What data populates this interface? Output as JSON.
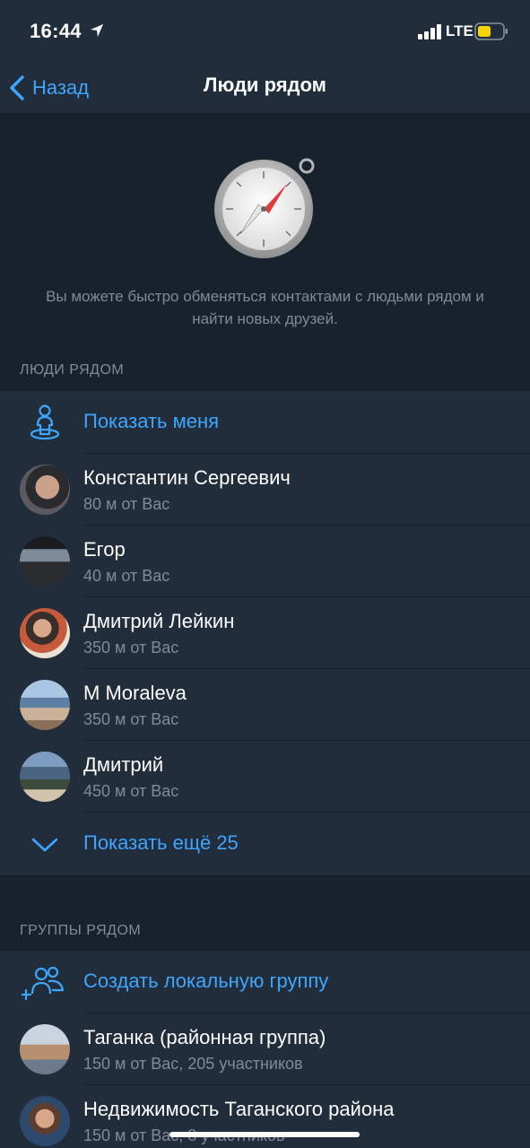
{
  "status_bar": {
    "time": "16:44",
    "network": "LTE",
    "battery_color": "#f5d400"
  },
  "nav": {
    "back_label": "Назад",
    "title": "Люди рядом"
  },
  "hero": {
    "description": "Вы можете быстро обменяться контактами с людьми рядом и найти новых друзей."
  },
  "people_section": {
    "header": "ЛЮДИ РЯДОМ",
    "show_me_label": "Показать меня",
    "people": [
      {
        "name": "Константин Сергеевич",
        "distance": "80 м от Вас"
      },
      {
        "name": "Егор",
        "distance": "40 м от Вас"
      },
      {
        "name": "Дмитрий Лейкин",
        "distance": "350 м от Вас"
      },
      {
        "name": "M Moraleva",
        "distance": "350 м от Вас"
      },
      {
        "name": "Дмитрий",
        "distance": "450 м от Вас"
      }
    ],
    "show_more_label": "Показать ещё 25"
  },
  "groups_section": {
    "header": "ГРУППЫ РЯДОМ",
    "create_label": "Создать локальную группу",
    "groups": [
      {
        "name": "Таганка (районная группа)",
        "info": "150 м от Вас, 205 участников"
      },
      {
        "name": "Недвижимость Таганского района",
        "info": "150 м от Вас, 8 участников"
      }
    ]
  },
  "colors": {
    "accent": "#3ea6ff",
    "background": "#18222d",
    "cell": "#212d3b",
    "secondary_text": "#7f8b99"
  }
}
